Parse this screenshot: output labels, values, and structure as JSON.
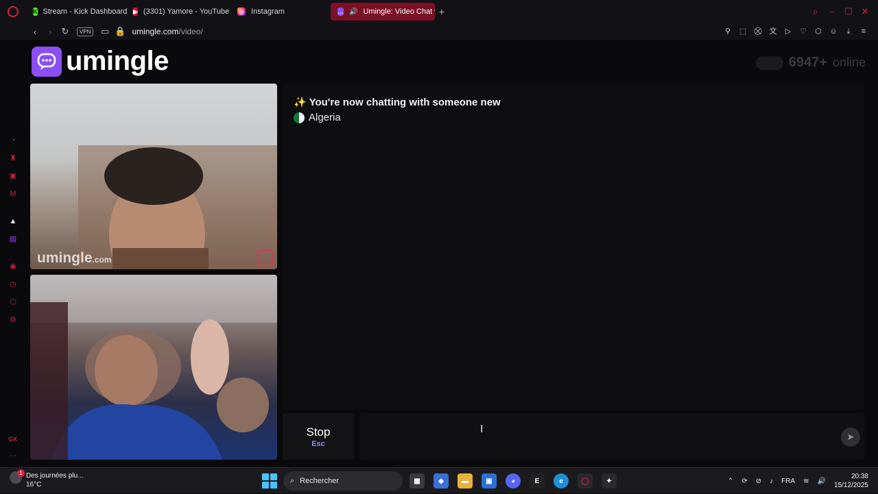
{
  "browser": {
    "tabs": [
      {
        "label": "Stream - Kick Dashboard",
        "icon": "kick-icon",
        "color": "#53fc18"
      },
      {
        "label": "(3301) Yamore - YouTube",
        "icon": "youtube-icon",
        "color": "#ff0033"
      },
      {
        "label": "Instagram",
        "icon": "instagram-icon",
        "color": "#e1306c"
      },
      {
        "label": "Umingle: Video Chat w",
        "icon": "umingle-icon",
        "color": "#8a4ff5",
        "active": true
      }
    ],
    "new_tab": "+",
    "vpn_label": "VPN",
    "url_domain": "umingle.com",
    "url_path": "/video/",
    "accent": "#d4213d"
  },
  "page": {
    "logo_text": "umingle",
    "online_count": "6947+",
    "online_label": "online",
    "watermark_main": "umingle",
    "watermark_suffix": ".com",
    "chat": {
      "status_message": "✨ You're now chatting with someone new",
      "country": "Algeria"
    },
    "stop_button": {
      "label": "Stop",
      "shortcut": "Esc"
    },
    "message_input": {
      "value": "",
      "placeholder": ""
    }
  },
  "sidebar": {
    "gx_label": "GX",
    "more": "···"
  },
  "taskbar": {
    "weather_title": "Des journées plu...",
    "weather_temp": "16°C",
    "weather_badge": "1",
    "search_placeholder": "Rechercher",
    "language": "FRA",
    "time": "20:38",
    "date": "15/12/2025"
  }
}
